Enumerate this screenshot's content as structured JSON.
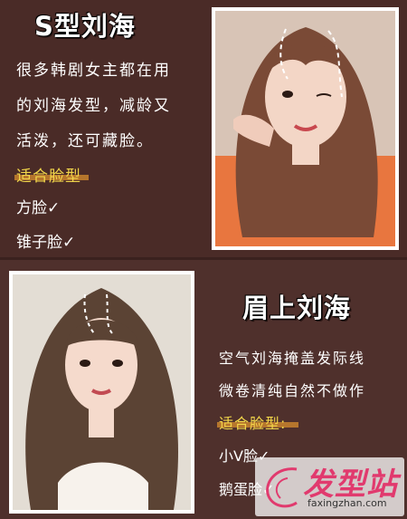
{
  "section1": {
    "title": "S型刘海",
    "description": [
      "很多韩剧女主都在用",
      "的刘海发型，减龄又",
      "活泼，还可藏脸。"
    ],
    "fit_label": "适合脸型",
    "fit_items": [
      "方脸✓",
      "锥子脸✓"
    ]
  },
  "section2": {
    "title": "眉上刘海",
    "description": [
      "空气刘海掩盖发际线",
      "微卷清纯自然不做作"
    ],
    "fit_label": "适合脸型:",
    "fit_items": [
      "小V脸✓",
      "鹅蛋脸✓"
    ]
  },
  "watermark": {
    "brand": "发型站",
    "url": "faxingzhan.com"
  },
  "colors": {
    "background_top": "#4a2b27",
    "background_bottom": "#4f302c",
    "highlight": "#f2d64a",
    "brand_pink": "#e13a6e"
  }
}
